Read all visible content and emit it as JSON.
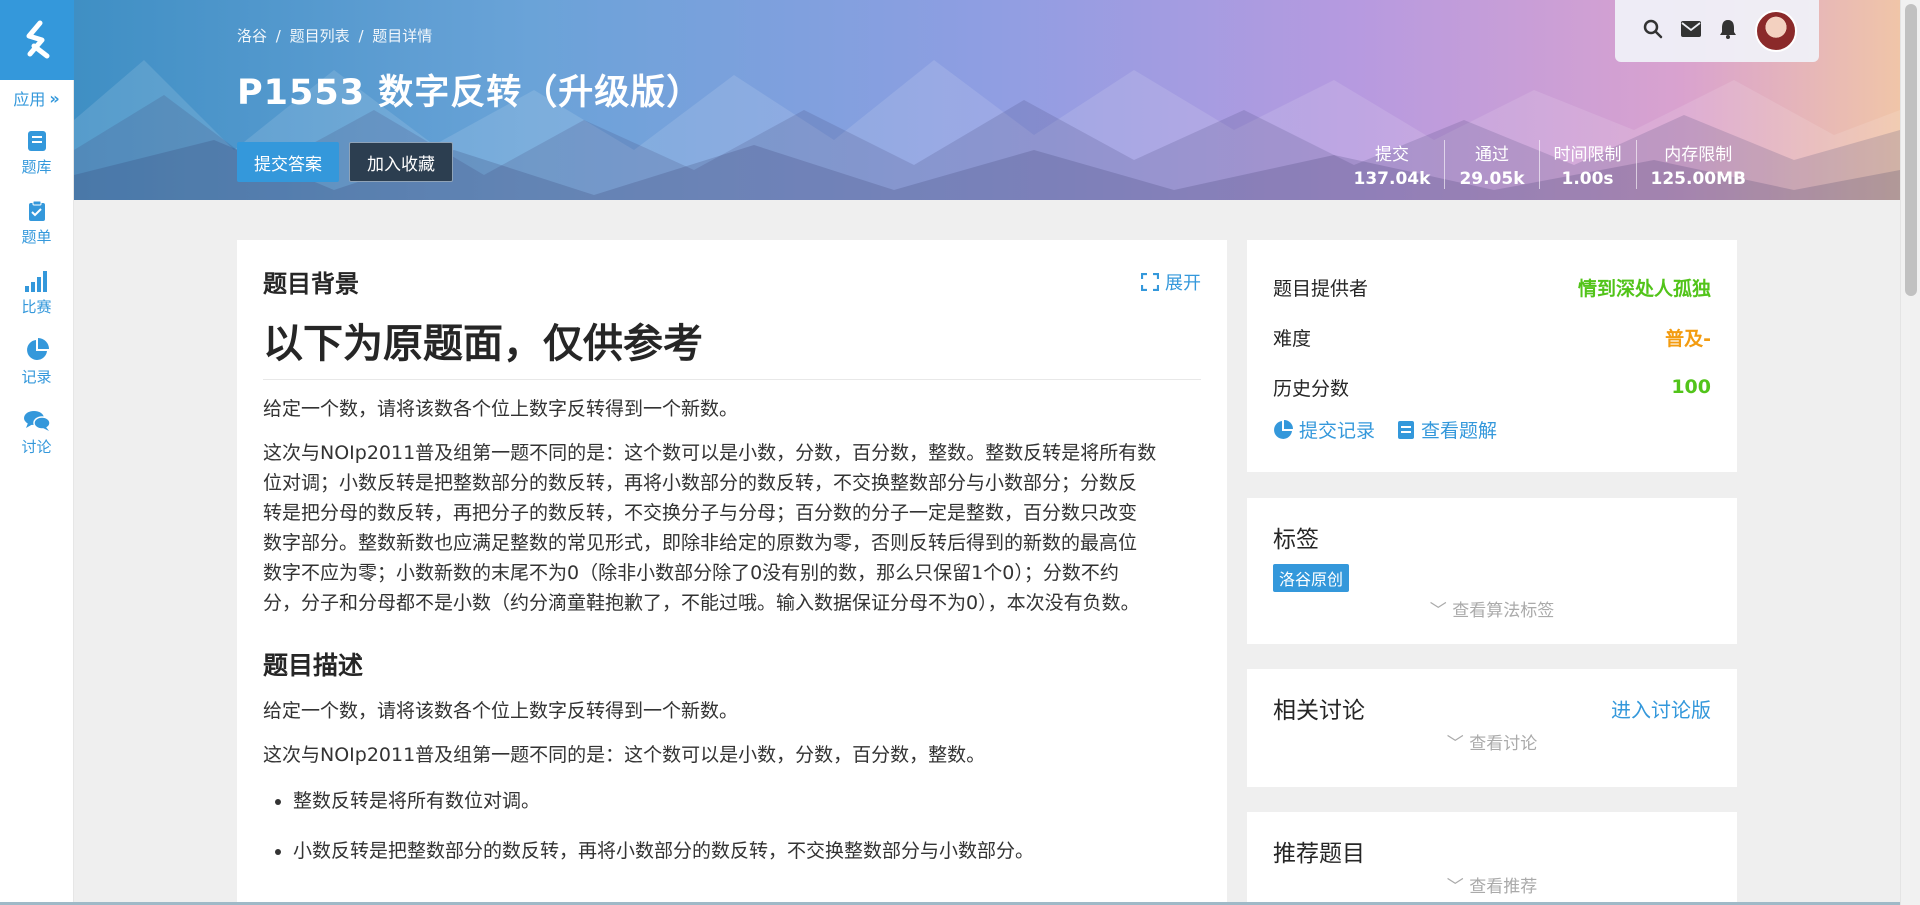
{
  "sidebar": {
    "app_label": "应用",
    "items": [
      {
        "label": "题库",
        "icon": "book-icon"
      },
      {
        "label": "题单",
        "icon": "clipboard-icon"
      },
      {
        "label": "比赛",
        "icon": "bar-chart-icon"
      },
      {
        "label": "记录",
        "icon": "pie-chart-icon"
      },
      {
        "label": "讨论",
        "icon": "chat-icon"
      }
    ]
  },
  "header": {
    "breadcrumb": [
      "洛谷",
      "/",
      "题目列表",
      "/",
      "题目详情"
    ],
    "title": "P1553 数字反转（升级版）",
    "submit_button": "提交答案",
    "favorite_button": "加入收藏",
    "stats": [
      {
        "label": "提交",
        "value": "137.04k"
      },
      {
        "label": "通过",
        "value": "29.05k"
      },
      {
        "label": "时间限制",
        "value": "1.00s"
      },
      {
        "label": "内存限制",
        "value": "125.00MB"
      }
    ]
  },
  "main": {
    "background_title": "题目背景",
    "expand_label": "展开",
    "big_title": "以下为原题面，仅供参考",
    "bg_para1": "给定一个数，请将该数各个位上数字反转得到一个新数。",
    "bg_para2_lines": [
      "这次与NOIp2011普及组第一题不同的是：这个数可以是小数，分数，百分数，整数。整数反转是将所有数",
      "位对调；小数反转是把整数部分的数反转，再将小数部分的数反转，不交换整数部分与小数部分；分数反",
      "转是把分母的数反转，再把分子的数反转，不交换分子与分母；百分数的分子一定是整数，百分数只改变",
      "数字部分。整数新数也应满足整数的常见形式，即除非给定的原数为零，否则反转后得到的新数的最高位",
      "数字不应为零；小数新数的末尾不为0（除非小数部分除了0没有别的数，那么只保留1个0）；分数不约",
      "分，分子和分母都不是小数（约分滴童鞋抱歉了，不能过哦。输入数据保证分母不为0），本次没有负数。"
    ],
    "desc_title": "题目描述",
    "desc_para1": "给定一个数，请将该数各个位上数字反转得到一个新数。",
    "desc_para2": "这次与NOIp2011普及组第一题不同的是：这个数可以是小数，分数，百分数，整数。",
    "bullets": [
      "整数反转是将所有数位对调。",
      "小数反转是把整数部分的数反转，再将小数部分的数反转，不交换整数部分与小数部分。"
    ]
  },
  "info_card": {
    "provider_label": "题目提供者",
    "provider_value": "情到深处人孤独",
    "difficulty_label": "难度",
    "difficulty_value": "普及-",
    "score_label": "历史分数",
    "score_value": "100",
    "submissions_link": "提交记录",
    "solutions_link": "查看题解"
  },
  "tags_card": {
    "title": "标签",
    "tag": "洛谷原创",
    "more": "查看算法标签"
  },
  "discussion_card": {
    "title": "相关讨论",
    "link": "进入讨论版",
    "more": "查看讨论"
  },
  "recommend_card": {
    "title": "推荐题目",
    "more": "查看推荐"
  },
  "colors": {
    "accent": "#3498db",
    "provider": "#52c41a",
    "difficulty": "#f39c11"
  }
}
